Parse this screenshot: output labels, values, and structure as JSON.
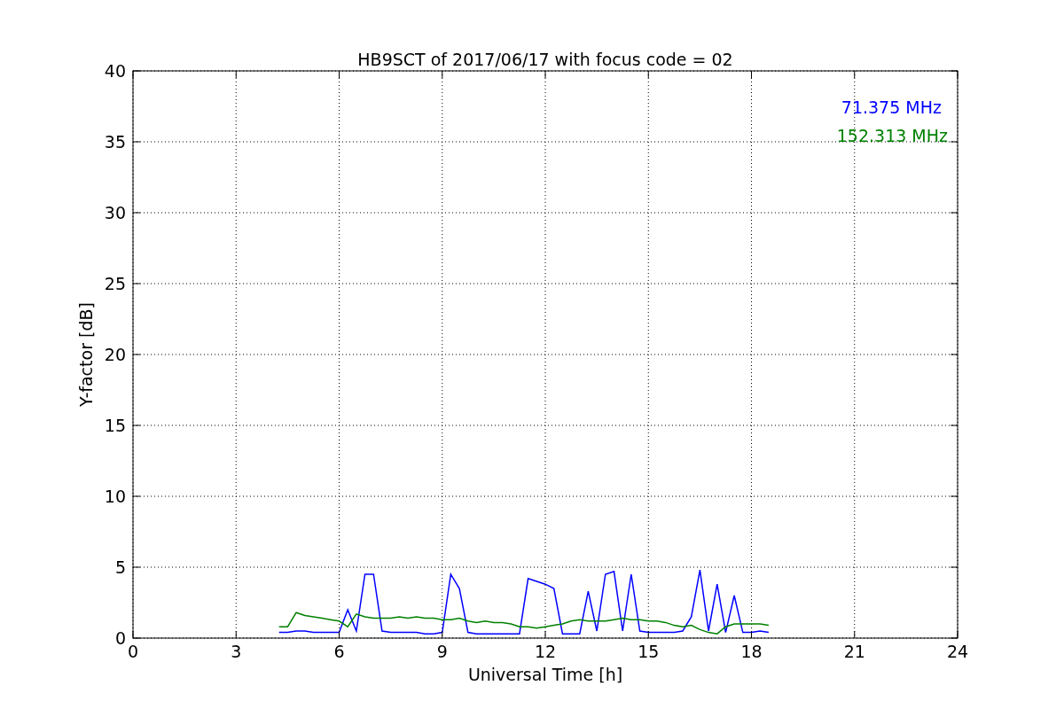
{
  "chart_data": {
    "type": "line",
    "title": "HB9SCT of 2017/06/17 with focus code = 02",
    "xlabel": "Universal Time [h]",
    "ylabel": "Y-factor [dB]",
    "x": [
      4.25,
      4.5,
      4.75,
      5,
      5.25,
      5.5,
      5.75,
      6,
      6.25,
      6.5,
      6.75,
      7,
      7.25,
      7.5,
      7.75,
      8,
      8.25,
      8.5,
      8.75,
      9,
      9.25,
      9.5,
      9.75,
      10,
      10.25,
      10.5,
      10.75,
      11,
      11.25,
      11.5,
      11.75,
      12,
      12.25,
      12.5,
      12.75,
      13,
      13.25,
      13.5,
      13.75,
      14,
      14.25,
      14.5,
      14.75,
      15,
      15.25,
      15.5,
      15.75,
      16,
      16.25,
      16.5,
      16.75,
      17,
      17.25,
      17.5,
      17.75,
      18,
      18.25,
      18.5
    ],
    "series": [
      {
        "name": "71.375 MHz",
        "color": "#0000ff",
        "values": [
          0.4,
          0.4,
          0.5,
          0.5,
          0.4,
          0.4,
          0.4,
          0.4,
          2.0,
          0.5,
          4.5,
          4.5,
          0.5,
          0.4,
          0.4,
          0.4,
          0.4,
          0.3,
          0.3,
          0.4,
          4.5,
          3.5,
          0.4,
          0.3,
          0.3,
          0.3,
          0.3,
          0.3,
          0.3,
          4.2,
          4.0,
          3.8,
          3.5,
          0.3,
          0.3,
          0.3,
          3.3,
          0.5,
          4.5,
          4.7,
          0.5,
          4.5,
          0.5,
          0.4,
          0.4,
          0.4,
          0.4,
          0.5,
          1.5,
          4.8,
          0.5,
          3.8,
          0.4,
          3.0,
          0.4,
          0.4,
          0.5,
          0.4
        ]
      },
      {
        "name": "152.313 MHz",
        "color": "#008000",
        "values": [
          0.8,
          0.8,
          1.8,
          1.6,
          1.5,
          1.4,
          1.3,
          1.2,
          0.8,
          1.7,
          1.5,
          1.4,
          1.4,
          1.4,
          1.5,
          1.4,
          1.5,
          1.4,
          1.4,
          1.3,
          1.3,
          1.4,
          1.2,
          1.1,
          1.2,
          1.1,
          1.1,
          1.0,
          0.8,
          0.8,
          0.7,
          0.8,
          0.9,
          1.0,
          1.2,
          1.3,
          1.2,
          1.2,
          1.2,
          1.3,
          1.4,
          1.3,
          1.3,
          1.2,
          1.2,
          1.1,
          0.9,
          0.8,
          0.9,
          0.6,
          0.4,
          0.3,
          0.8,
          1.0,
          1.0,
          1.0,
          1.0,
          0.9
        ]
      }
    ],
    "xlim": [
      0,
      24
    ],
    "ylim": [
      0,
      40
    ],
    "xticks": [
      0,
      3,
      6,
      9,
      12,
      15,
      18,
      21,
      24
    ],
    "yticks": [
      0,
      5,
      10,
      15,
      20,
      25,
      30,
      35,
      40
    ],
    "grid": true
  }
}
